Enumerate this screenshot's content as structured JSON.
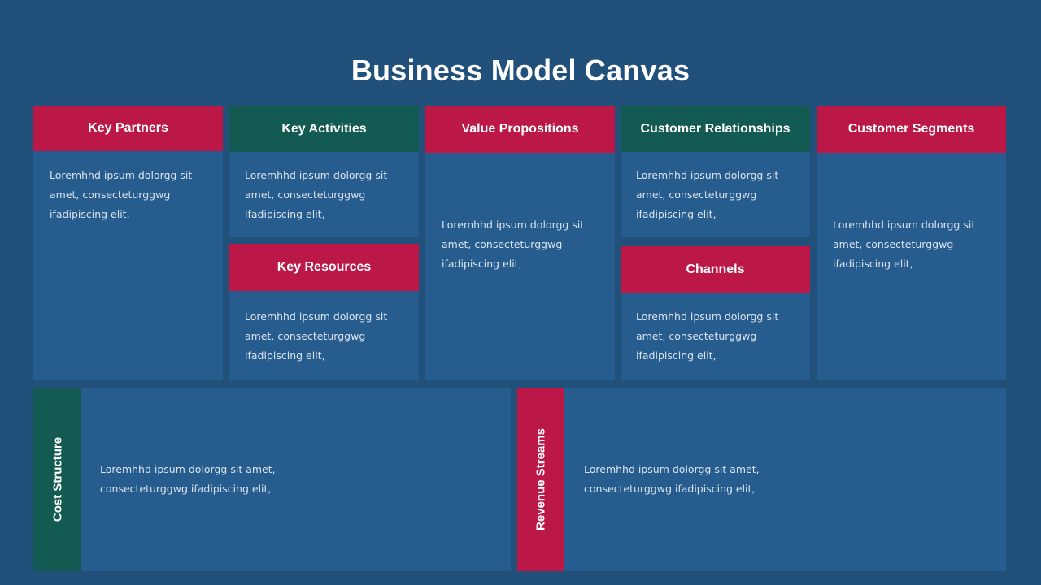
{
  "title": "Business Model Canvas",
  "colors": {
    "background": "#21507b",
    "panel": "#265c8e",
    "accent_red": "#bb1848",
    "accent_green": "#135a52",
    "text": "#dbe4ee"
  },
  "blocks": {
    "key_partners": {
      "label": "Key Partners",
      "text": "Loremhhd ipsum dolorgg sit amet, consecteturggwg ifadipiscing elit,"
    },
    "key_activities": {
      "label": "Key Activities",
      "text": "Loremhhd ipsum dolorgg sit amet, consecteturggwg ifadipiscing elit,"
    },
    "key_resources": {
      "label": "Key Resources",
      "text": "Loremhhd ipsum dolorgg sit amet, consecteturggwg ifadipiscing elit,"
    },
    "value_propositions": {
      "label": "Value Propositions",
      "text": "Loremhhd ipsum dolorgg sit amet, consecteturggwg ifadipiscing elit,"
    },
    "customer_relationships": {
      "label": "Customer Relationships",
      "text": "Loremhhd ipsum dolorgg sit amet, consecteturggwg ifadipiscing elit,"
    },
    "channels": {
      "label": "Channels",
      "text": "Loremhhd ipsum dolorgg sit amet, consecteturggwg ifadipiscing elit,"
    },
    "customer_segments": {
      "label": "Customer Segments",
      "text": "Loremhhd ipsum dolorgg sit amet, consecteturggwg ifadipiscing elit,"
    },
    "cost_structure": {
      "label": "Cost Structure",
      "text": "Loremhhd ipsum dolorgg sit amet, consecteturggwg ifadipiscing elit,"
    },
    "revenue_streams": {
      "label": "Revenue Streams",
      "text": "Loremhhd ipsum dolorgg sit amet, consecteturggwg ifadipiscing elit,"
    }
  }
}
